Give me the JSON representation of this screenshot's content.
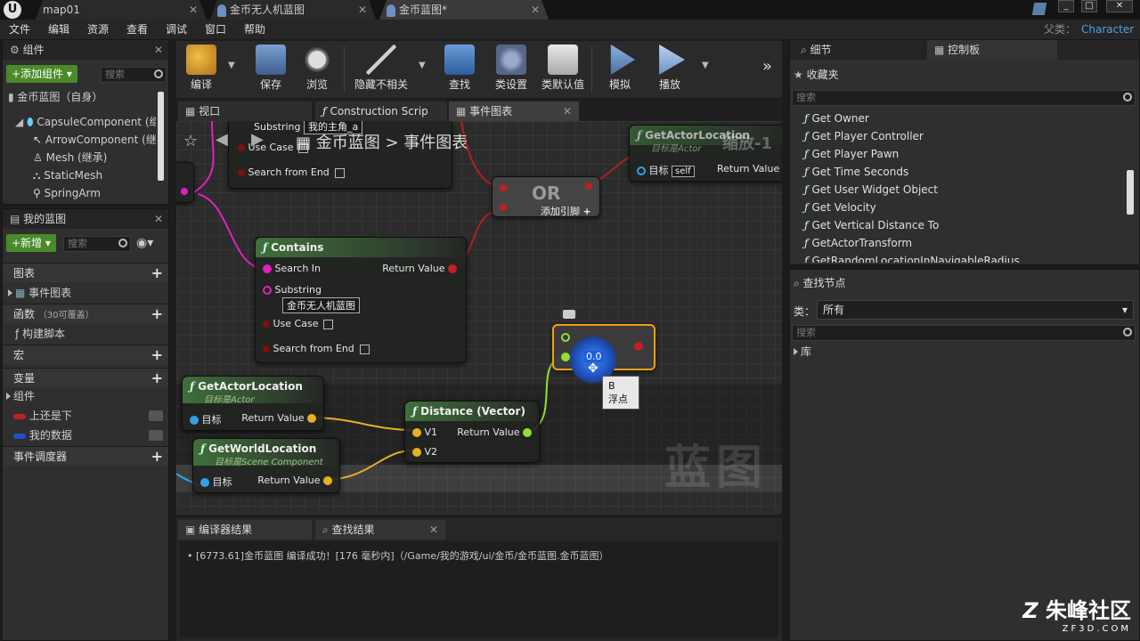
{
  "titlebar": {
    "tabs": [
      {
        "label": "map01"
      },
      {
        "label": "金币无人机蓝图"
      },
      {
        "label": "金币蓝图*"
      }
    ]
  },
  "menubar": {
    "items": [
      "文件",
      "编辑",
      "资源",
      "查看",
      "调试",
      "窗口",
      "帮助"
    ],
    "parent_label": "父类：",
    "parent_value": "Character"
  },
  "components_panel": {
    "title": "组件",
    "add_button": "+添加组件",
    "search_placeholder": "搜索",
    "root": "金币蓝图（自身）",
    "items": [
      "CapsuleComponent (继承)",
      "ArrowComponent (继承)",
      "Mesh (继承)",
      "StaticMesh",
      "SpringArm"
    ]
  },
  "my_blueprint": {
    "title": "我的蓝图",
    "new_button": "+新增",
    "search_placeholder": "搜索",
    "sections": {
      "graphs": "图表",
      "event_graph": "事件图表",
      "functions": "函数",
      "functions_count": "（30可覆盖）",
      "construction": "构建脚本",
      "macros": "宏",
      "variables": "变量",
      "components": "组件",
      "var1": "上还是下",
      "var2": "我的数据",
      "dispatchers": "事件调度器"
    }
  },
  "toolbar": {
    "buttons": [
      "编译",
      "保存",
      "浏览",
      "隐藏不相关",
      "查找",
      "类设置",
      "类默认值",
      "模拟",
      "播放"
    ]
  },
  "graph": {
    "tabs": [
      "视口",
      "Construction Scrip",
      "事件图表"
    ],
    "breadcrumb_root": "金币蓝图",
    "breadcrumb_sep": ">",
    "breadcrumb_current": "事件图表",
    "watermark": "蓝图",
    "nodes": {
      "top_substring": "Substring",
      "top_substring_val": "我的主角_a",
      "top_usecase": "Use Case",
      "top_search_end": "Search from End",
      "or_title": "OR",
      "or_add_pin": "添加引脚",
      "contains_title": "Contains",
      "search_in": "Search In",
      "return_value": "Return Value",
      "substring": "Substring",
      "substring_value": "金币无人机蓝图",
      "use_case": "Use Case",
      "search_from_end": "Search from End",
      "get_actor_location": "GetActorLocation",
      "target_actor": "目标是Actor",
      "target": "目标",
      "get_world_location": "GetWorldLocation",
      "target_scene": "目标是Scene Component",
      "distance": "Distance (Vector)",
      "v1": "V1",
      "v2": "V2",
      "top_get_actor": "GetActorLocation",
      "top_target_actor": "目标是Actor",
      "top_scale": "缩放-1",
      "self": "self",
      "compare_value": "0.0",
      "tooltip_b": "B",
      "tooltip_float": "浮点"
    }
  },
  "bottom_panel": {
    "tabs": [
      "编译器结果",
      "查找结果"
    ],
    "log": "[6773.61]金币蓝图 编译成功！[176 毫秒内]（/Game/我的游戏/ui/金币/金币蓝图.金币蓝图）"
  },
  "details_panel": {
    "tabs": [
      "细节",
      "控制板"
    ],
    "favorites": "收藏夹",
    "search_placeholder": "搜索",
    "functions": [
      "Get Owner",
      "Get Player Controller",
      "Get Player Pawn",
      "Get Time Seconds",
      "Get User Widget Object",
      "Get Velocity",
      "Get Vertical Distance To",
      "GetActorTransform",
      "GetRandomLocationInNavigableRadius"
    ]
  },
  "find_nodes": {
    "title": "查找节点",
    "category_label": "类：",
    "category_value": "所有",
    "search_placeholder": "搜索",
    "library": "库"
  },
  "site_watermark": {
    "name": "朱峰社区",
    "url": "ZF3D.COM"
  },
  "colors": {
    "accent_green": "#4a8a2a",
    "parent_blue": "#4f9fe8",
    "pin_red": "#c02020",
    "pin_magenta": "#e020c0",
    "pin_yellow": "#e8b020",
    "pin_lime": "#90e030",
    "pin_blue": "#30a0e8"
  }
}
